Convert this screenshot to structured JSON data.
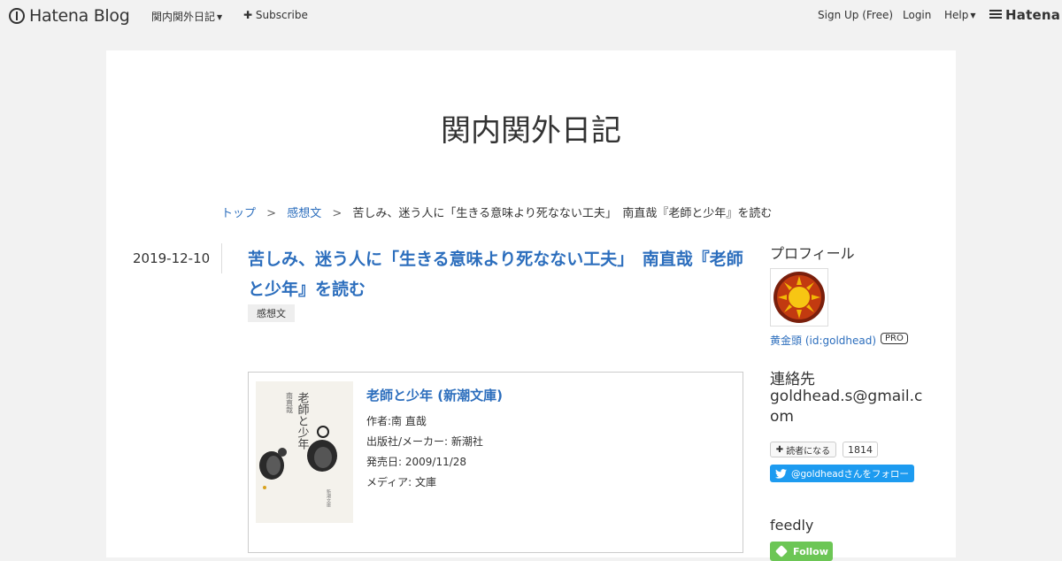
{
  "topbar": {
    "logo_text": "Hatena Blog",
    "blog_menu_label": "関内関外日記",
    "subscribe_label": "Subscribe",
    "signup_label": "Sign Up (Free)",
    "login_label": "Login",
    "help_label": "Help",
    "hatena_label": "Hatena"
  },
  "blog": {
    "title": "関内関外日記"
  },
  "breadcrumb": {
    "top": "トップ",
    "category": "感想文",
    "current": "苦しみ、迷う人に「生きる意味より死なない工夫」　南直哉『老師と少年』を読む",
    "separator": ">"
  },
  "entry": {
    "date": "2019-12-10",
    "title": "苦しみ、迷う人に「生きる意味より死なない工夫」　南直哉『老師と少年』を読む",
    "category": "感想文"
  },
  "book": {
    "title": "老師と少年 (新潮文庫)",
    "author": "作者:南 直哉",
    "publisher": "出版社/メーカー: 新潮社",
    "release_date": "発売日: 2009/11/28",
    "media": "メディア: 文庫",
    "cover_title": "老師と少年",
    "cover_author": "南直哉",
    "cover_publisher": "新潮文庫"
  },
  "sidebar": {
    "profile_heading": "プロフィール",
    "profile_name": "黄金頭 (id:goldhead)",
    "pro_badge": "PRO",
    "contact_heading": "連絡先",
    "contact_email": "goldhead.s@gmail.com",
    "reader_button": "読者になる",
    "reader_count": "1814",
    "twitter_button": "@goldheadさんをフォロー",
    "feedly_heading": "feedly",
    "feedly_button": "Follow"
  },
  "colors": {
    "link": "#2c6ebd",
    "background": "#f2f2f2",
    "twitter": "#1d9bf0",
    "feedly": "#6cc655"
  }
}
